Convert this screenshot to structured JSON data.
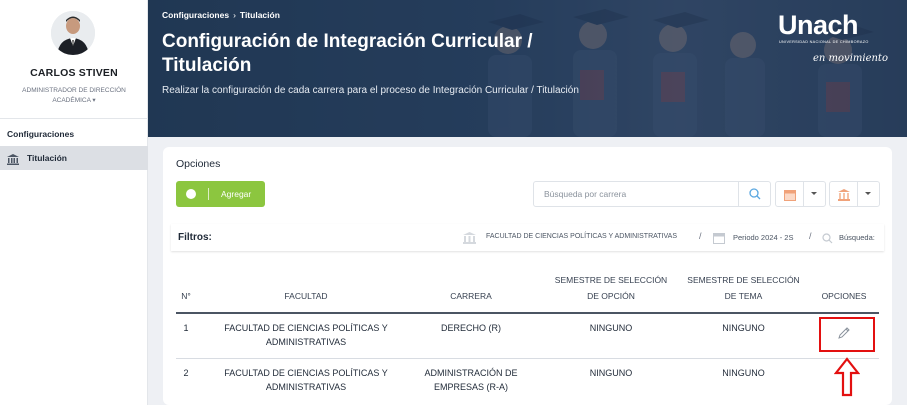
{
  "user": {
    "name": "CARLOS STIVEN",
    "role": "ADMINISTRADOR DE DIRECCIÓN ACADÉMICA ▾"
  },
  "sidebar": {
    "section": "Configuraciones",
    "items": [
      {
        "label": "Titulación",
        "icon": "building-columns-icon"
      }
    ]
  },
  "header": {
    "breadcrumb": [
      "Configuraciones",
      "Titulación"
    ],
    "breadcrumb_sep": "›",
    "title": "Configuración de Integración Curricular / Titulación",
    "subtitle": "Realizar la configuración de cada carrera para el proceso de Integración Curricular / Titulación",
    "brand": {
      "name": "Unach",
      "tagline": "UNIVERSIDAD NACIONAL DE CHIMBORAZO",
      "slogan": "en movimiento"
    }
  },
  "panel": {
    "title": "Opciones",
    "add_label": "Agregar",
    "search_placeholder": "Búsqueda por carrera",
    "filters_label": "Filtros:",
    "filters": [
      "FACULTAD DE CIENCIAS POLÍTICAS Y ADMINISTRATIVAS",
      "Periodo 2024 - 2S",
      "Búsqueda:"
    ],
    "filter_sep": "/"
  },
  "table": {
    "headers": [
      "N°",
      "FACULTAD",
      "CARRERA",
      "SEMESTRE DE SELECCIÓN DE OPCIÓN",
      "SEMESTRE DE SELECCIÓN DE TEMA",
      "OPCIONES"
    ],
    "rows": [
      {
        "n": "1",
        "facultad": "FACULTAD DE CIENCIAS POLÍTICAS Y ADMINISTRATIVAS",
        "carrera": "DERECHO (R)",
        "opcion": "NINGUNO",
        "tema": "NINGUNO"
      },
      {
        "n": "2",
        "facultad": "FACULTAD DE CIENCIAS POLÍTICAS Y ADMINISTRATIVAS",
        "carrera": "ADMINISTRACIÓN DE EMPRESAS (R-A)",
        "opcion": "NINGUNO",
        "tema": "NINGUNO"
      }
    ]
  },
  "colors": {
    "accent_green": "#8cc63f",
    "hero_blue": "#233a55",
    "highlight_red": "#e31010",
    "calendar_orange": "#f0a27a"
  }
}
